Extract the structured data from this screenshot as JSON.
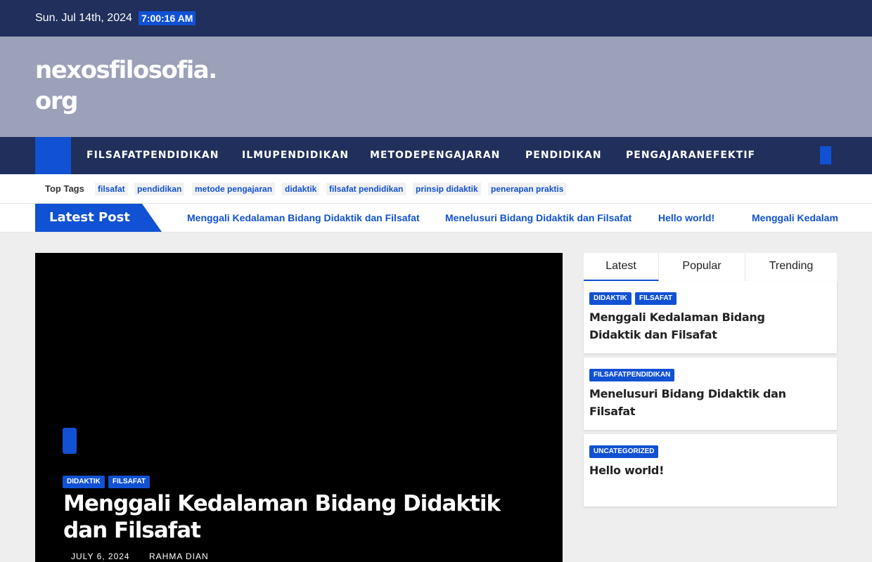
{
  "topbar": {
    "date": "Sun. Jul 14th, 2024",
    "time": "7:00:16 AM"
  },
  "header": {
    "site_title": "nexosfilosofia.org"
  },
  "nav": {
    "items": [
      "FILSAFATPENDIDIKAN",
      "ILMUPENDIDIKAN",
      "METODEPENGAJARAN",
      "PENDIDIKAN",
      "PENGAJARANEFEKTIF"
    ],
    "home_icon": "home-icon",
    "search_icon": "search-icon"
  },
  "tags": {
    "label": "Top Tags",
    "items": [
      "filsafat",
      "pendidikan",
      "metode pengajaran",
      "didaktik",
      "filsafat pendidikan",
      "prinsip didaktik",
      "penerapan praktis"
    ]
  },
  "ticker": {
    "label": "Latest Post",
    "links": [
      "Menggali Kedalaman Bidang Didaktik dan Filsafat",
      "Menelusuri Bidang Didaktik dan Filsafat",
      "Hello world!",
      "Menggali Kedalaman Bidang Didaktik dan Filsafat"
    ]
  },
  "hero": {
    "categories": [
      "DIDAKTIK",
      "FILSAFAT"
    ],
    "title": "Menggali Kedalaman Bidang Didaktik dan Filsafat",
    "date": "JULY 6, 2024",
    "author": "RAHMA DIAN"
  },
  "sidebar": {
    "tabs": [
      "Latest",
      "Popular",
      "Trending"
    ],
    "posts": [
      {
        "categories": [
          "DIDAKTIK",
          "FILSAFAT"
        ],
        "title": "Menggali Kedalaman Bidang Didaktik dan Filsafat"
      },
      {
        "categories": [
          "FILSAFATPENDIDIKAN"
        ],
        "title": "Menelusuri Bidang Didaktik dan Filsafat"
      },
      {
        "categories": [
          "UNCATEGORIZED"
        ],
        "title": "Hello world!"
      }
    ]
  },
  "colors": {
    "primary": "#1151d3",
    "navy": "#202f5b",
    "header_bg": "#9aa1b8"
  }
}
